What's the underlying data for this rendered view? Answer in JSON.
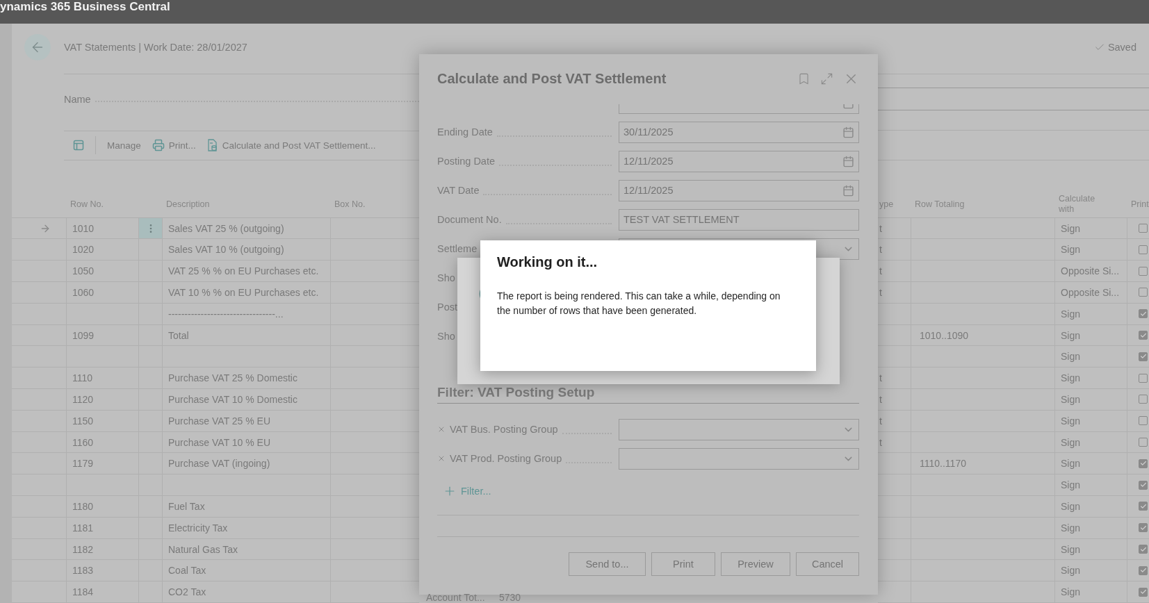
{
  "app_title": "ynamics 365 Business Central",
  "page": {
    "title": "VAT Statements | Work Date: 28/01/2027",
    "status": "Saved",
    "name_label": "Name"
  },
  "toolbar": [
    {
      "kind": "layout"
    },
    {
      "kind": "text",
      "label": "Manage"
    },
    {
      "kind": "print",
      "label": "Print..."
    },
    {
      "kind": "calc",
      "label": "Calculate and Post VAT Settlement..."
    }
  ],
  "table": {
    "columns_left": [
      "Row No.",
      "Description",
      "Box No."
    ],
    "columns_right": [
      "ype",
      "Row Totaling",
      "Calculate with",
      "Print"
    ],
    "rows": [
      {
        "row_no": "1010",
        "description": "Sales VAT 25 % (outgoing)",
        "type_tail": "t",
        "calculate_with": "Sign",
        "print": false,
        "selected": true
      },
      {
        "row_no": "1020",
        "description": "Sales VAT 10 % (outgoing)",
        "type_tail": "t",
        "calculate_with": "Sign",
        "print": false,
        "selected": false
      },
      {
        "row_no": "1050",
        "description": "VAT 25 % % on EU Purchases etc.",
        "type_tail": "t",
        "calculate_with": "Opposite Si...",
        "print": false,
        "selected": false
      },
      {
        "row_no": "1060",
        "description": "VAT 10 % % on EU Purchases etc.",
        "type_tail": "t",
        "calculate_with": "Opposite Si...",
        "print": false,
        "selected": false
      },
      {
        "description": "---------------------------------...",
        "calculate_with": "Sign",
        "print": true,
        "selected": false
      },
      {
        "row_no": "1099",
        "description": "Total",
        "row_totaling": "1010..1090",
        "calculate_with": "Sign",
        "print": true,
        "selected": false
      },
      {
        "calculate_with": "Sign",
        "print": true,
        "selected": false
      },
      {
        "row_no": "1110",
        "description": "Purchase VAT 25 % Domestic",
        "type_tail": "t",
        "calculate_with": "Sign",
        "print": false,
        "selected": false
      },
      {
        "row_no": "1120",
        "description": "Purchase VAT 10 % Domestic",
        "type_tail": "t",
        "calculate_with": "Sign",
        "print": false,
        "selected": false
      },
      {
        "row_no": "1150",
        "description": "Purchase VAT 25 % EU",
        "type_tail": "t",
        "calculate_with": "Sign",
        "print": false,
        "selected": false
      },
      {
        "row_no": "1160",
        "description": "Purchase VAT 10 % EU",
        "type_tail": "t",
        "calculate_with": "Sign",
        "print": false,
        "selected": false
      },
      {
        "row_no": "1179",
        "description": "Purchase VAT (ingoing)",
        "row_totaling": "1110..1170",
        "calculate_with": "Sign",
        "print": true,
        "selected": false
      },
      {
        "calculate_with": "Sign",
        "print": true,
        "selected": false
      },
      {
        "row_no": "1180",
        "description": "Fuel Tax",
        "calculate_with": "Sign",
        "print": true,
        "selected": false
      },
      {
        "row_no": "1181",
        "description": "Electricity Tax",
        "calculate_with": "Sign",
        "print": true,
        "selected": false
      },
      {
        "row_no": "1182",
        "description": "Natural Gas Tax",
        "calculate_with": "Sign",
        "print": true,
        "selected": false
      },
      {
        "row_no": "1183",
        "description": "Coal Tax",
        "calculate_with": "Sign",
        "print": true,
        "selected": false
      },
      {
        "row_no": "1184",
        "description": "CO2 Tax",
        "calculate_with": "Sign",
        "print": true,
        "selected": false
      }
    ],
    "partial_row": [
      "Account Tot...",
      "5730"
    ]
  },
  "dialog": {
    "title": "Calculate and Post VAT Settlement",
    "fields": [
      {
        "kind": "date"
      },
      {
        "label": "Ending Date",
        "value": "30/11/2025",
        "kind": "date"
      },
      {
        "label": "Posting Date",
        "value": "12/11/2025",
        "kind": "date"
      },
      {
        "label": "VAT Date",
        "value": "12/11/2025",
        "kind": "date"
      },
      {
        "label": "Document No.",
        "value": "TEST VAT SETTLEMENT",
        "kind": "text"
      },
      {
        "label": "Settleme",
        "kind": "dropdown"
      },
      {
        "label": "Sho",
        "kind": "hidden"
      },
      {
        "label": "Post",
        "kind": "hidden"
      },
      {
        "label": "Sho",
        "kind": "hidden"
      }
    ],
    "filter": {
      "title": "Filter: VAT Posting Setup",
      "fields": [
        {
          "label": "VAT Bus. Posting Group"
        },
        {
          "label": "VAT Prod. Posting Group"
        }
      ],
      "add_label": "Filter..."
    },
    "buttons": [
      "Send to...",
      "Print",
      "Preview",
      "Cancel"
    ]
  },
  "progress": {
    "title": "Working on it...",
    "message": "The report is being rendered. This can take a while, depending on the number of rows that have been generated."
  }
}
